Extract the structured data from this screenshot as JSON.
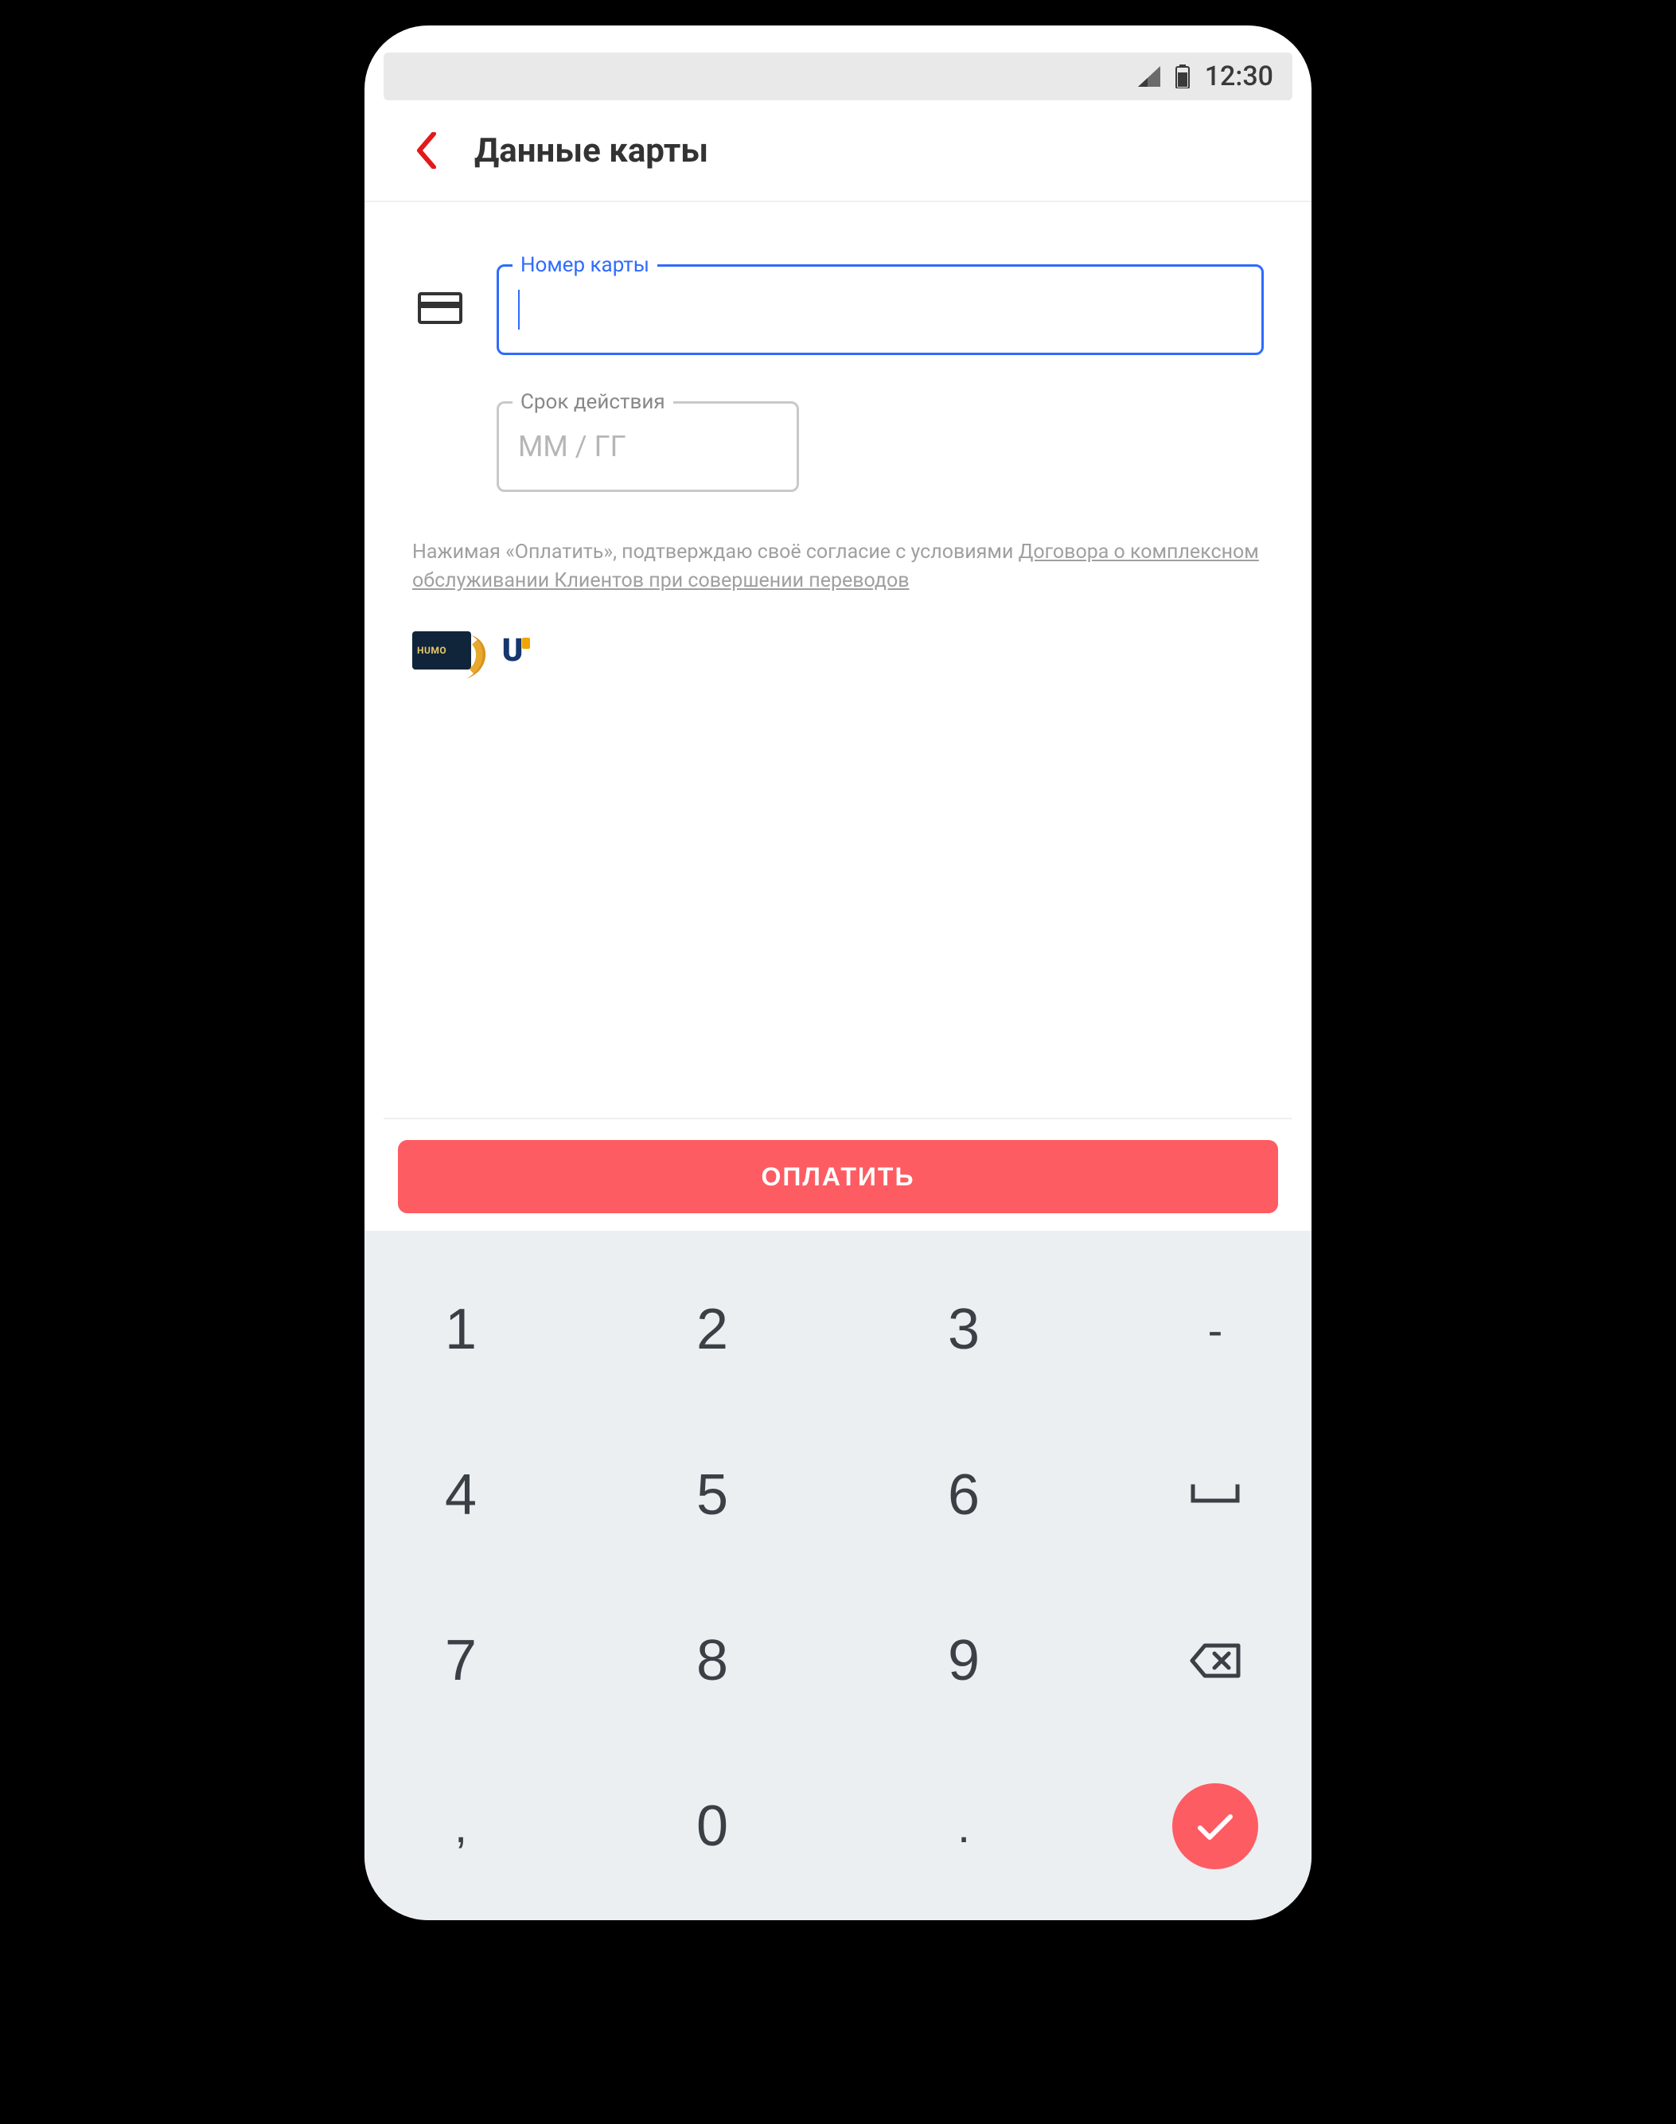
{
  "statusbar": {
    "time": "12:30"
  },
  "header": {
    "title": "Данные карты"
  },
  "form": {
    "card_number_label": "Номер карты",
    "card_number_value": "",
    "expiry_label": "Срок действия",
    "expiry_placeholder": "ММ / ГГ"
  },
  "consent": {
    "prefix": "Нажимая «Оплатить», подтверждаю своё согласие с условиями ",
    "link_text": "Договора о комплексном обслуживании Клиентов при совершении переводов"
  },
  "brands": {
    "humo_label": "HUMO",
    "uzcard_label": "U"
  },
  "pay_button": {
    "label": "ОПЛАТИТЬ"
  },
  "keypad": {
    "keys": [
      "1",
      "2",
      "3",
      "-",
      "4",
      "5",
      "6",
      "",
      "7",
      "8",
      "9",
      "",
      ",",
      "0",
      ".",
      ""
    ],
    "minus": "-",
    "comma": ",",
    "dot": "."
  },
  "colors": {
    "accent_blue": "#2F6BFF",
    "accent_red": "#fd5c63",
    "text_primary": "#333333",
    "text_muted": "#9f9f9f",
    "keypad_bg": "#eceff1"
  }
}
